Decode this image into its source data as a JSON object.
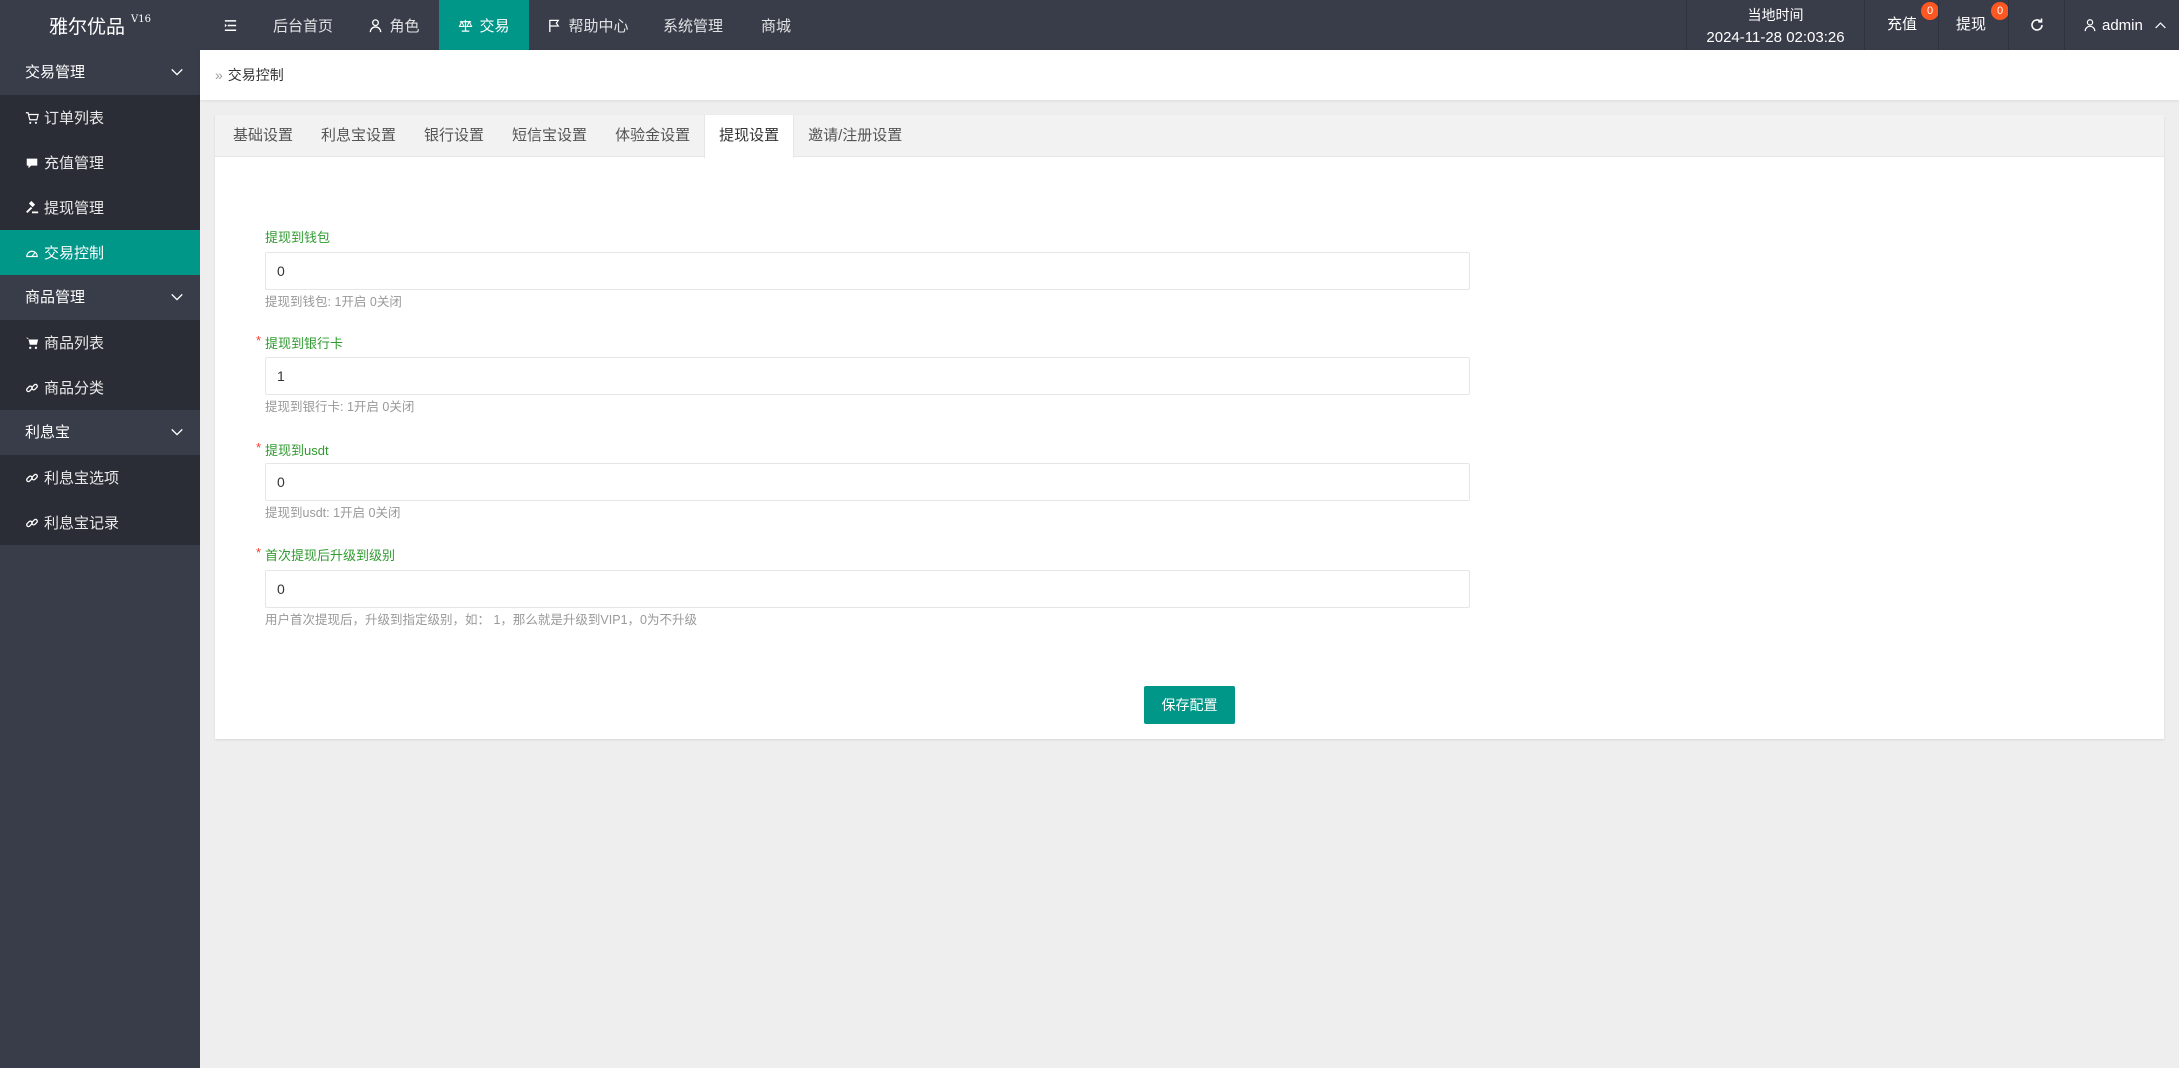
{
  "app": {
    "logo": "雅尔优品",
    "version": "V16"
  },
  "header": {
    "nav": [
      {
        "label": "后台首页"
      },
      {
        "label": "角色",
        "icon": "user-icon"
      },
      {
        "label": "交易",
        "icon": "balance-scale-icon",
        "active": true
      },
      {
        "label": "帮助中心",
        "icon": "flag-icon"
      },
      {
        "label": "系统管理"
      },
      {
        "label": "商城"
      }
    ],
    "time_label": "当地时间",
    "time_value": "2024-11-28 02:03:26",
    "recharge": {
      "label": "充值",
      "badge": "0"
    },
    "withdraw": {
      "label": "提现",
      "badge": "0"
    },
    "user": "admin"
  },
  "sidebar": {
    "groups": [
      {
        "label": "交易管理",
        "items": [
          {
            "label": "订单列表",
            "icon": "cart-icon"
          },
          {
            "label": "充值管理",
            "icon": "comment-icon"
          },
          {
            "label": "提现管理",
            "icon": "gavel-icon"
          },
          {
            "label": "交易控制",
            "icon": "dashboard-icon",
            "active": true
          }
        ]
      },
      {
        "label": "商品管理",
        "items": [
          {
            "label": "商品列表",
            "icon": "shopping-cart-icon"
          },
          {
            "label": "商品分类",
            "icon": "link-icon"
          }
        ]
      },
      {
        "label": "利息宝",
        "items": [
          {
            "label": "利息宝选项",
            "icon": "link-icon"
          },
          {
            "label": "利息宝记录",
            "icon": "link-icon"
          }
        ]
      }
    ]
  },
  "breadcrumb": {
    "sep": "»",
    "current": "交易控制"
  },
  "tabs": [
    {
      "label": "基础设置"
    },
    {
      "label": "利息宝设置"
    },
    {
      "label": "银行设置"
    },
    {
      "label": "短信宝设置"
    },
    {
      "label": "体验金设置"
    },
    {
      "label": "提现设置",
      "active": true
    },
    {
      "label": "邀请/注册设置"
    }
  ],
  "form": {
    "required_mark": "*",
    "fields": [
      {
        "label": "提现到钱包",
        "required": false,
        "value": "0",
        "help": "提现到钱包: 1开启 0关闭"
      },
      {
        "label": "提现到银行卡",
        "required": true,
        "value": "1",
        "help": "提现到银行卡: 1开启 0关闭"
      },
      {
        "label": "提现到usdt",
        "required": true,
        "value": "0",
        "help": "提现到usdt: 1开启 0关闭"
      },
      {
        "label": "首次提现后升级到级别",
        "required": true,
        "value": "0",
        "help": "用户首次提现后，升级到指定级别，如： 1，那么就是升级到VIP1，0为不升级"
      }
    ],
    "save_label": "保存配置"
  },
  "colors": {
    "header": "#393D49",
    "accent": "#009688",
    "badge": "#FF5722",
    "label": "#2f9a2f"
  }
}
